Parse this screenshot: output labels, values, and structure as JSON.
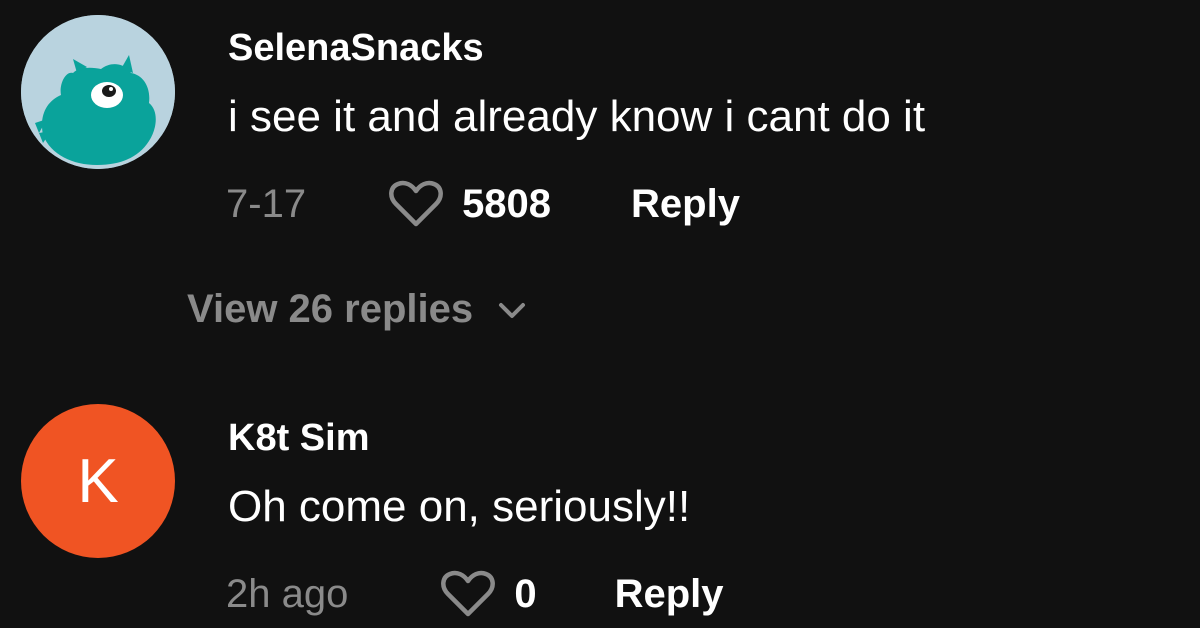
{
  "comments": [
    {
      "username": "SelenaSnacks",
      "text": "i see it and already know i cant do it",
      "date": "7-17",
      "likes": "5808",
      "reply_label": "Reply",
      "avatar": {
        "kind": "image",
        "icon": "teal-monster-avatar",
        "bg": "#b9d3df",
        "fg": "#0aa39b"
      }
    },
    {
      "username": "K8t Sim",
      "text": "Oh come on, seriously!!",
      "date": "2h ago",
      "likes": "0",
      "reply_label": "Reply",
      "avatar": {
        "kind": "letter",
        "letter": "K",
        "bg": "#f05423"
      }
    }
  ],
  "view_replies": {
    "label": "View 26 replies",
    "icon": "chevron-down-icon"
  },
  "colors": {
    "background": "#111111",
    "primary_text": "#ffffff",
    "secondary_text": "#8a8a8a"
  }
}
